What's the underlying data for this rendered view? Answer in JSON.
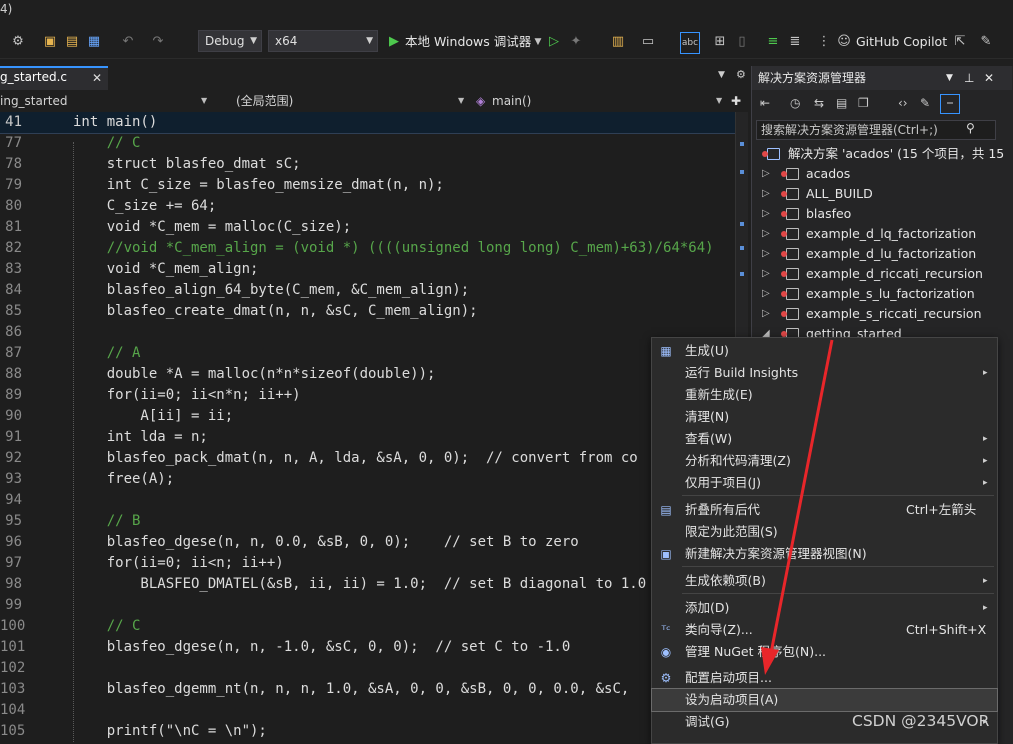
{
  "toolbar": {
    "config": "Debug",
    "platform": "x64",
    "run_label": "本地 Windows 调试器",
    "copilot_label": "GitHub Copilot"
  },
  "editor": {
    "tab_label": "g_started.c",
    "nav": {
      "project": "ing_started",
      "scope": "(全局范围)",
      "member": "main()"
    },
    "lines": [
      {
        "n": "41",
        "t": "int main()"
      },
      {
        "n": "77",
        "t": "    // C"
      },
      {
        "n": "78",
        "t": "    struct blasfeo_dmat sC;"
      },
      {
        "n": "79",
        "t": "    int C_size = blasfeo_memsize_dmat(n, n);"
      },
      {
        "n": "80",
        "t": "    C_size += 64;"
      },
      {
        "n": "81",
        "t": "    void *C_mem = malloc(C_size);"
      },
      {
        "n": "82",
        "t": "    //void *C_mem_align = (void *) ((((unsigned long long) C_mem)+63)/64*64)"
      },
      {
        "n": "83",
        "t": "    void *C_mem_align;"
      },
      {
        "n": "84",
        "t": "    blasfeo_align_64_byte(C_mem, &C_mem_align);"
      },
      {
        "n": "85",
        "t": "    blasfeo_create_dmat(n, n, &sC, C_mem_align);"
      },
      {
        "n": "86",
        "t": ""
      },
      {
        "n": "87",
        "t": "    // A"
      },
      {
        "n": "88",
        "t": "    double *A = malloc(n*n*sizeof(double));"
      },
      {
        "n": "89",
        "t": "    for(ii=0; ii<n*n; ii++)"
      },
      {
        "n": "90",
        "t": "        A[ii] = ii;"
      },
      {
        "n": "91",
        "t": "    int lda = n;"
      },
      {
        "n": "92",
        "t": "    blasfeo_pack_dmat(n, n, A, lda, &sA, 0, 0);  // convert from co"
      },
      {
        "n": "93",
        "t": "    free(A);"
      },
      {
        "n": "94",
        "t": ""
      },
      {
        "n": "95",
        "t": "    // B"
      },
      {
        "n": "96",
        "t": "    blasfeo_dgese(n, n, 0.0, &sB, 0, 0);    // set B to zero"
      },
      {
        "n": "97",
        "t": "    for(ii=0; ii<n; ii++)"
      },
      {
        "n": "98",
        "t": "        BLASFEO_DMATEL(&sB, ii, ii) = 1.0;  // set B diagonal to 1.0"
      },
      {
        "n": "99",
        "t": ""
      },
      {
        "n": "100",
        "t": "    // C"
      },
      {
        "n": "101",
        "t": "    blasfeo_dgese(n, n, -1.0, &sC, 0, 0);  // set C to -1.0"
      },
      {
        "n": "102",
        "t": ""
      },
      {
        "n": "103",
        "t": "    blasfeo_dgemm_nt(n, n, n, 1.0, &sA, 0, 0, &sB, 0, 0, 0.0, &sC,"
      },
      {
        "n": "104",
        "t": ""
      },
      {
        "n": "105",
        "t": "    printf(\"\\nC = \\n\");"
      }
    ]
  },
  "solution_explorer": {
    "title": "解决方案资源管理器",
    "search_placeholder": "搜索解决方案资源管理器(Ctrl+;)",
    "root": "解决方案 'acados' (15 个项目，共 15",
    "items": [
      "acados",
      "ALL_BUILD",
      "blasfeo",
      "example_d_lq_factorization",
      "example_d_lu_factorization",
      "example_d_riccati_recursion",
      "example_s_lu_factorization",
      "example_s_riccati_recursion",
      "getting_started"
    ]
  },
  "context_menu": {
    "items": [
      {
        "label": "生成(U)"
      },
      {
        "label": "运行 Build Insights",
        "sub": "▸"
      },
      {
        "label": "重新生成(E)"
      },
      {
        "label": "清理(N)"
      },
      {
        "label": "查看(W)",
        "sub": "▸"
      },
      {
        "label": "分析和代码清理(Z)",
        "sub": "▸"
      },
      {
        "label": "仅用于项目(J)",
        "sub": "▸"
      },
      {
        "label": "折叠所有后代",
        "shortcut": "Ctrl+左箭头"
      },
      {
        "label": "限定为此范围(S)"
      },
      {
        "label": "新建解决方案资源管理器视图(N)"
      },
      {
        "label": "生成依赖项(B)",
        "sub": "▸"
      },
      {
        "label": "添加(D)",
        "sub": "▸"
      },
      {
        "label": "类向导(Z)...",
        "shortcut": "Ctrl+Shift+X"
      },
      {
        "label": "管理 NuGet 程序包(N)..."
      },
      {
        "label": "配置启动项目..."
      },
      {
        "label": "设为启动项目(A)"
      },
      {
        "label": "调试(G)",
        "sub": "▸"
      }
    ]
  },
  "watermark": "CSDN @2345VOR",
  "colors": {
    "arrow": "#e8262a",
    "accent": "#3794ff"
  }
}
